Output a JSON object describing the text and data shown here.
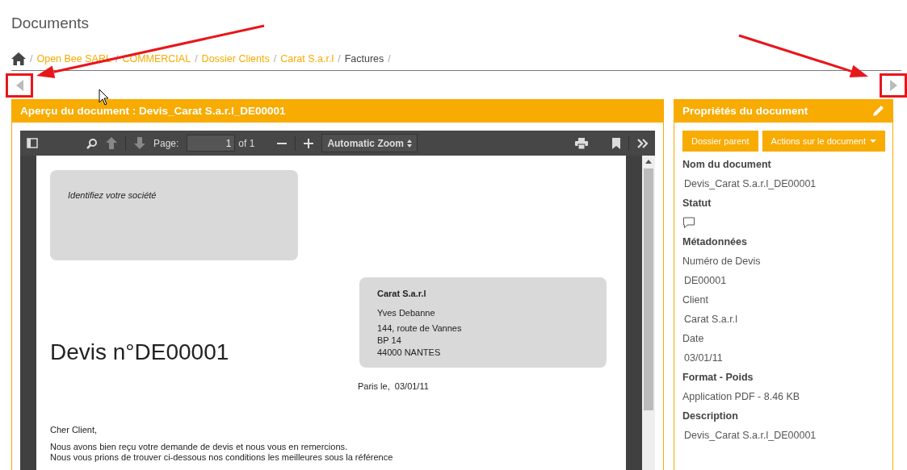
{
  "page_title": "Documents",
  "breadcrumb_separator": "/",
  "breadcrumb": [
    {
      "label": "Open Bee SARL",
      "current": false
    },
    {
      "label": "COMMERCIAL",
      "current": false
    },
    {
      "label": "Dossier Clients",
      "current": false
    },
    {
      "label": "Carat S.a.r.l",
      "current": false
    },
    {
      "label": "Factures",
      "current": true
    }
  ],
  "nav_buttons": [
    {
      "kind": "previous",
      "highlighted": true
    },
    {
      "kind": "next",
      "highlighted": true
    }
  ],
  "preview": {
    "title": "Aperçu du document : Devis_Carat S.a.r.l_DE00001",
    "toolbar": {
      "page_label": "Page:",
      "page_value": "1",
      "page_count": "of 1",
      "zoom": "Automatic Zoom"
    },
    "document": {
      "company_hint": "Identifiez votre société",
      "recipient": [
        {
          "text": "Carat S.a.r.l",
          "kind": "name"
        },
        {
          "text": "Yves Debanne",
          "kind": "line"
        },
        {
          "text": "144, route de Vannes",
          "kind": "line"
        },
        {
          "text": "BP 14",
          "kind": "line"
        },
        {
          "text": "44000 NANTES",
          "kind": "line"
        }
      ],
      "heading": "Devis n°DE00001",
      "place_date": "Paris le,  03/01/11",
      "greeting": "Cher Client,",
      "body": [
        "Nous avons bien reçu votre demande de devis et nous vous en remercions.",
        "Nous vous prions de trouver ci-dessous nos conditions les meilleures sous la référence"
      ]
    }
  },
  "properties": {
    "title": "Propriétés du document",
    "buttons": [
      {
        "label": "Dossier parent",
        "dropdown": false
      },
      {
        "label": "Actions sur le document",
        "dropdown": true
      }
    ],
    "entries": [
      {
        "kind": "heading",
        "text": "Nom du document"
      },
      {
        "kind": "value",
        "text": "Devis_Carat S.a.r.l_DE00001"
      },
      {
        "kind": "heading",
        "text": "Statut"
      },
      {
        "kind": "icon"
      },
      {
        "kind": "heading",
        "text": "Métadonnées"
      },
      {
        "kind": "label",
        "text": "Numéro de Devis"
      },
      {
        "kind": "value",
        "text": "DE00001"
      },
      {
        "kind": "label",
        "text": "Client"
      },
      {
        "kind": "value",
        "text": "Carat S.a.r.l"
      },
      {
        "kind": "label",
        "text": "Date"
      },
      {
        "kind": "value",
        "text": "03/01/11"
      },
      {
        "kind": "heading",
        "text": "Format - Poids"
      },
      {
        "kind": "label",
        "text": "Application PDF - 8.46 KB"
      },
      {
        "kind": "heading",
        "text": "Description"
      },
      {
        "kind": "value",
        "text": "Devis_Carat S.a.r.l_DE00001"
      }
    ]
  }
}
